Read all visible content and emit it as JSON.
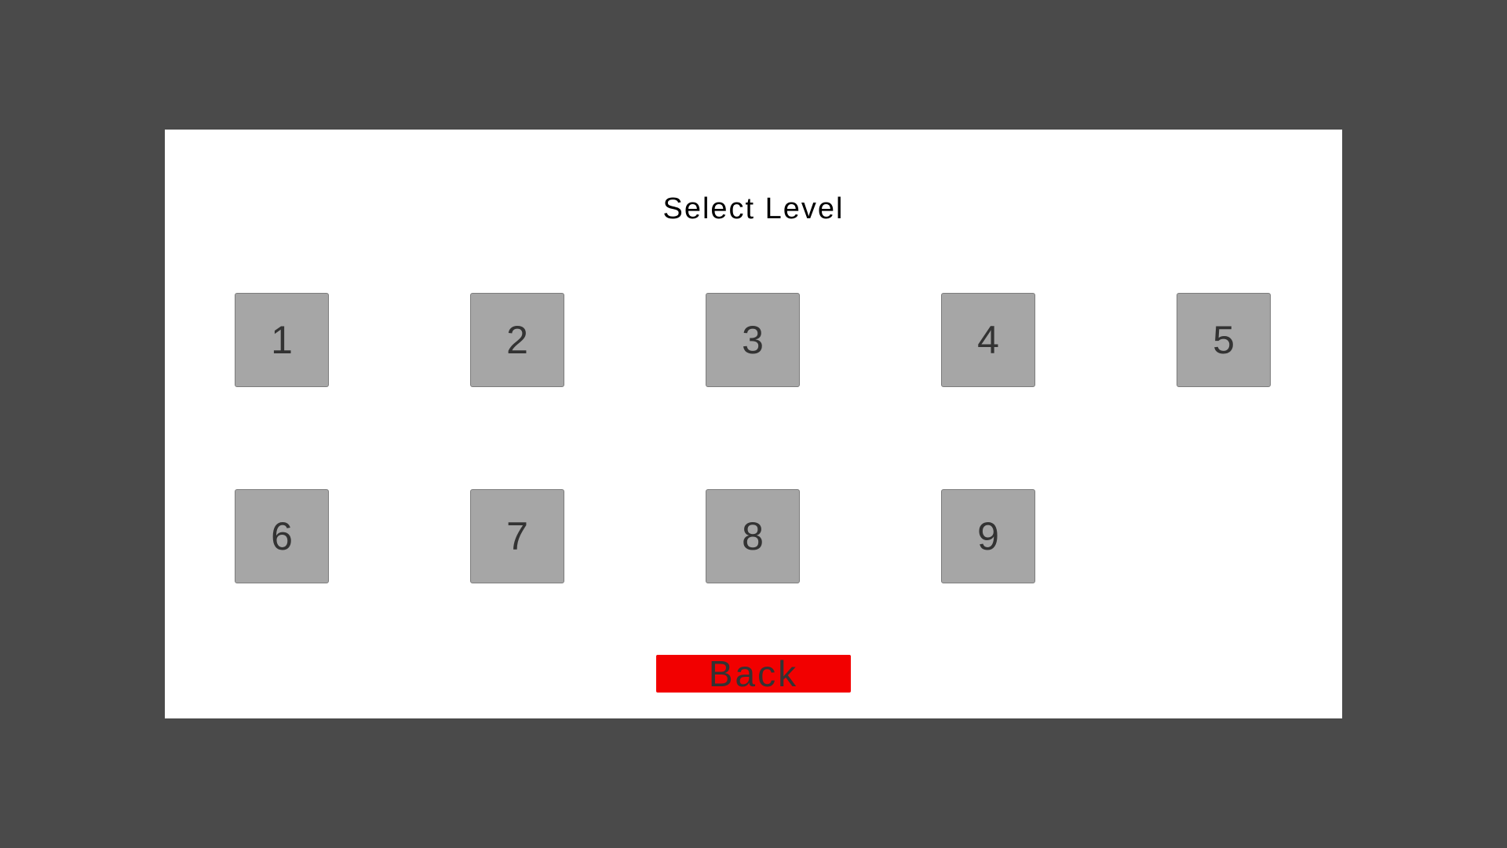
{
  "screen": {
    "title": "Select Level"
  },
  "levels": [
    {
      "label": "1"
    },
    {
      "label": "2"
    },
    {
      "label": "3"
    },
    {
      "label": "4"
    },
    {
      "label": "5"
    },
    {
      "label": "6"
    },
    {
      "label": "7"
    },
    {
      "label": "8"
    },
    {
      "label": "9"
    }
  ],
  "back": {
    "label": "Back"
  },
  "colors": {
    "background": "#4a4a4a",
    "panel": "#ffffff",
    "level_button": "#a6a6a6",
    "back_button": "#f20000",
    "button_text": "#333333"
  }
}
